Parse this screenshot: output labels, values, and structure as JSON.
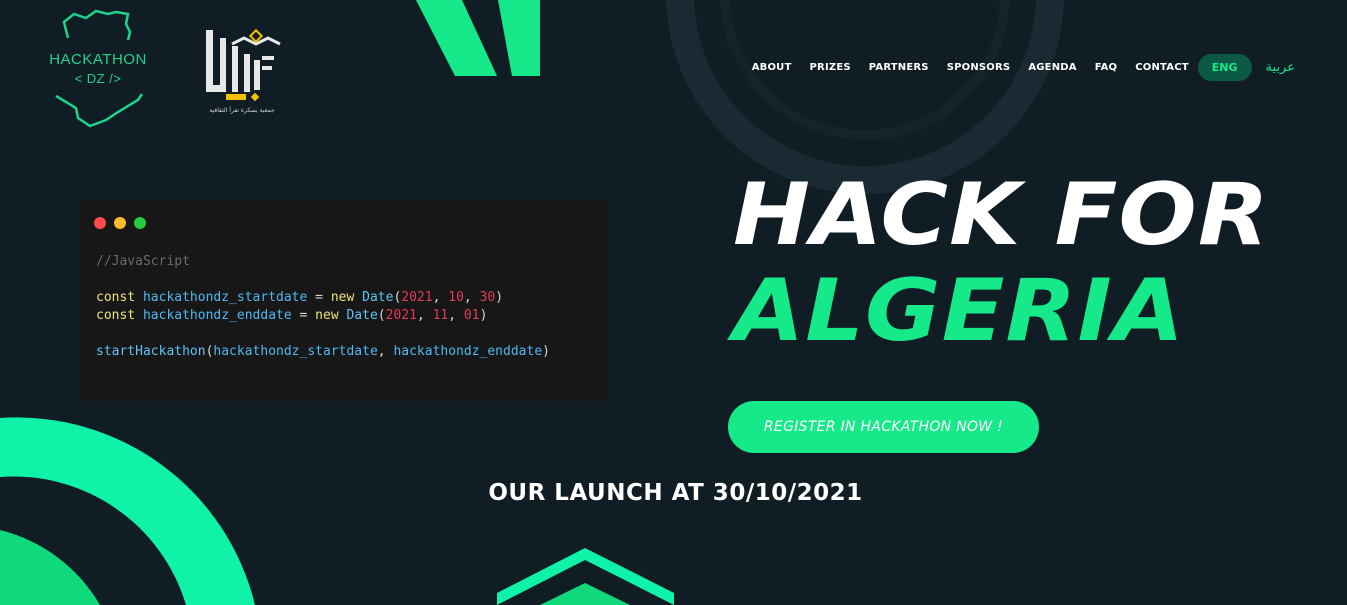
{
  "logo": {
    "hackathon_text": "HACKATHON",
    "hackathon_subtext": "< DZ />",
    "partner_tagline": "جمعية بسكرة تقرأ الثقافية"
  },
  "nav": {
    "items": [
      {
        "label": "ABOUT"
      },
      {
        "label": "PRIZES"
      },
      {
        "label": "PARTNERS"
      },
      {
        "label": "SPONSORS"
      },
      {
        "label": "AGENDA"
      },
      {
        "label": "FAQ"
      },
      {
        "label": "CONTACT"
      }
    ],
    "lang_active": "ENG",
    "lang_alt": "عربية"
  },
  "code_window": {
    "comment": "//JavaScript",
    "line1": {
      "kw": "const",
      "var": "hackathondz_startdate",
      "op": "=",
      "new": "new",
      "cls": "Date",
      "args": [
        "2021",
        "10",
        "30"
      ]
    },
    "line2": {
      "kw": "const",
      "var": "hackathondz_enddate",
      "op": "=",
      "new": "new",
      "cls": "Date",
      "args": [
        "2021",
        "11",
        "01"
      ]
    },
    "line3": {
      "fn": "startHackathon",
      "arg1": "hackathondz_startdate",
      "arg2": "hackathondz_enddate"
    }
  },
  "hero": {
    "line1": "HACK FOR",
    "line2": "ALGERIA",
    "cta": "REGISTER IN HACKATHON NOW !",
    "launch": "OUR LAUNCH AT 30/10/2021"
  },
  "colors": {
    "background": "#111d24",
    "accent": "#16e98a",
    "accent_dark": "#0c5a45",
    "code_bg": "#171717"
  },
  "icons": [
    "hackathon-dz-logo-icon",
    "iqraa-association-logo-icon",
    "window-close-dot",
    "window-minimize-dot",
    "window-maximize-dot"
  ]
}
